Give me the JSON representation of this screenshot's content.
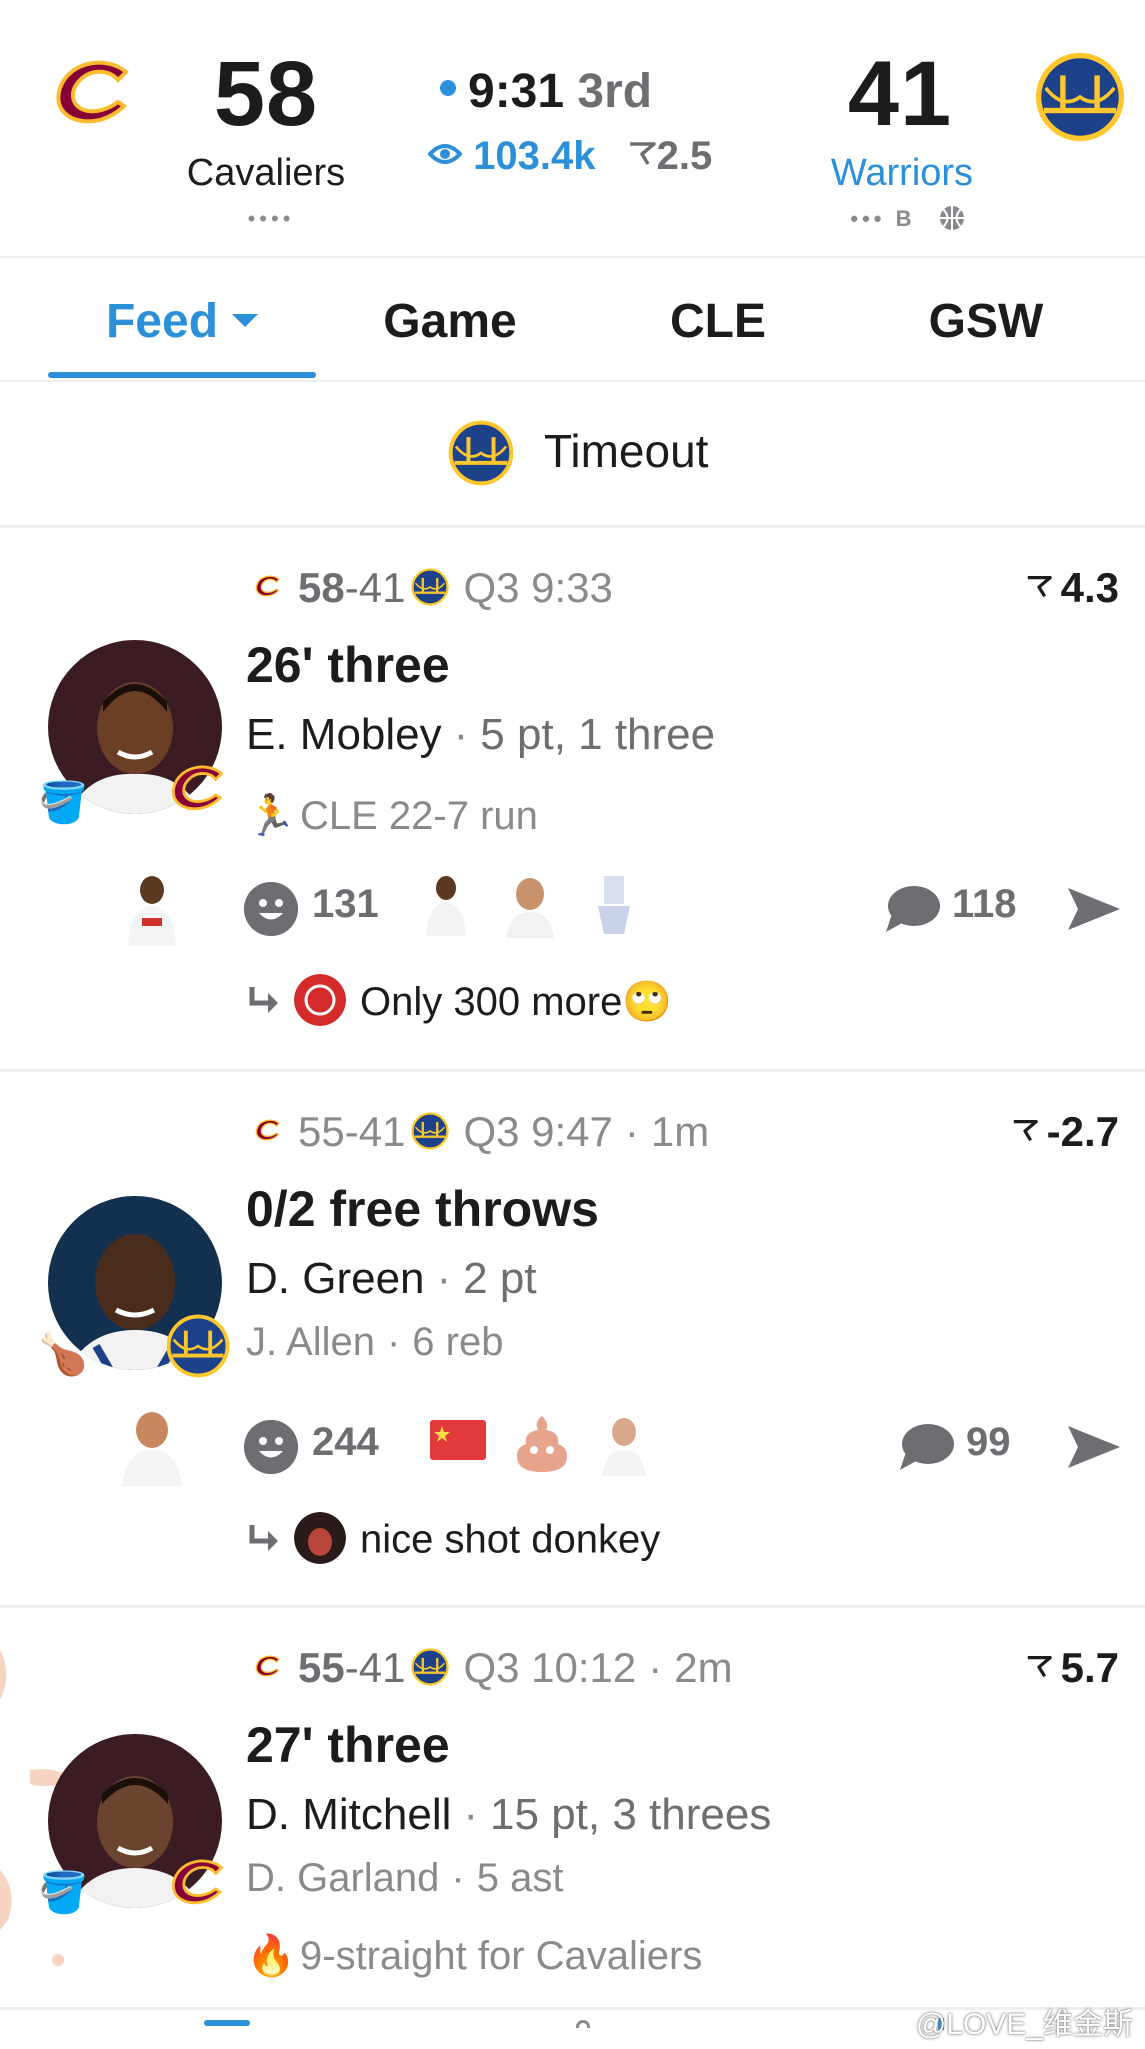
{
  "colors": {
    "accent": "#2b8fd9",
    "cavaliers": "#860038",
    "cavaliers_gold": "#fdbb30",
    "warriors_blue": "#1d428a",
    "warriors_gold": "#ffc72c"
  },
  "scoreboard": {
    "home": {
      "score": "58",
      "name": "Cavaliers",
      "indicator": "••••",
      "logo": "cavaliers-logo"
    },
    "away": {
      "score": "41",
      "name": "Warriors",
      "indicator": "••• B",
      "logo": "warriors-logo"
    },
    "clock": "9:31",
    "period": "3rd",
    "viewers": "103.4k",
    "spread": "2.5"
  },
  "tabs": [
    {
      "label": "Feed",
      "active": true
    },
    {
      "label": "Game"
    },
    {
      "label": "CLE"
    },
    {
      "label": "GSW"
    }
  ],
  "banner": {
    "text": "Timeout"
  },
  "feed": [
    {
      "home_score": "58",
      "away_score": "41",
      "time": "Q3 9:33",
      "age": "",
      "odds": "4.3",
      "headline": "26' three",
      "player": "E. Mobley",
      "player_stat": "5 pt, 1 three",
      "note_emoji": "🏃",
      "note": "CLE 22-7 run",
      "reactions": "131",
      "comments": "118",
      "reply": "Only 300 more🙄"
    },
    {
      "home_score": "55",
      "away_score": "41",
      "time": "Q3 9:47",
      "age": "1m",
      "odds": "-2.7",
      "headline": "0/2 free throws",
      "player": "D. Green",
      "player_stat": "2 pt",
      "assist": "J. Allen",
      "assist_stat": "6 reb",
      "reactions": "244",
      "comments": "99",
      "reply": "nice shot donkey"
    },
    {
      "home_score": "55",
      "away_score": "41",
      "time": "Q3 10:12",
      "age": "2m",
      "odds": "5.7",
      "headline": "27' three",
      "player": "D. Mitchell",
      "player_stat": "15 pt, 3 threes",
      "assist": "D. Garland",
      "assist_stat": "5 ast",
      "note_emoji": "🔥",
      "note": "9-straight for Cavaliers"
    }
  ],
  "icons": {
    "comment": "comment-icon",
    "share": "share-icon",
    "smile": "smile-icon",
    "odds": "odds-flag-icon",
    "reply": "reply-arrow-icon",
    "bucket": "🪣",
    "nugget": "🍗"
  },
  "watermark": "@LOVE_维金斯"
}
